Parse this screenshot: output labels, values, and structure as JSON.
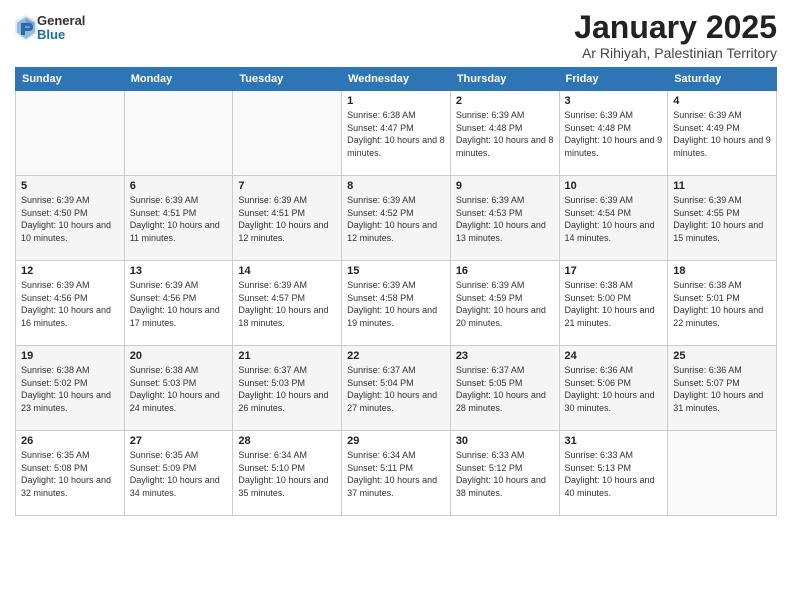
{
  "header": {
    "logo": {
      "general": "General",
      "blue": "Blue"
    },
    "title": "January 2025",
    "subtitle": "Ar Rihiyah, Palestinian Territory"
  },
  "calendar": {
    "weekdays": [
      "Sunday",
      "Monday",
      "Tuesday",
      "Wednesday",
      "Thursday",
      "Friday",
      "Saturday"
    ],
    "weeks": [
      [
        {
          "day": "",
          "sunrise": "",
          "sunset": "",
          "daylight": ""
        },
        {
          "day": "",
          "sunrise": "",
          "sunset": "",
          "daylight": ""
        },
        {
          "day": "",
          "sunrise": "",
          "sunset": "",
          "daylight": ""
        },
        {
          "day": "1",
          "sunrise": "Sunrise: 6:38 AM",
          "sunset": "Sunset: 4:47 PM",
          "daylight": "Daylight: 10 hours and 8 minutes."
        },
        {
          "day": "2",
          "sunrise": "Sunrise: 6:39 AM",
          "sunset": "Sunset: 4:48 PM",
          "daylight": "Daylight: 10 hours and 8 minutes."
        },
        {
          "day": "3",
          "sunrise": "Sunrise: 6:39 AM",
          "sunset": "Sunset: 4:48 PM",
          "daylight": "Daylight: 10 hours and 9 minutes."
        },
        {
          "day": "4",
          "sunrise": "Sunrise: 6:39 AM",
          "sunset": "Sunset: 4:49 PM",
          "daylight": "Daylight: 10 hours and 9 minutes."
        }
      ],
      [
        {
          "day": "5",
          "sunrise": "Sunrise: 6:39 AM",
          "sunset": "Sunset: 4:50 PM",
          "daylight": "Daylight: 10 hours and 10 minutes."
        },
        {
          "day": "6",
          "sunrise": "Sunrise: 6:39 AM",
          "sunset": "Sunset: 4:51 PM",
          "daylight": "Daylight: 10 hours and 11 minutes."
        },
        {
          "day": "7",
          "sunrise": "Sunrise: 6:39 AM",
          "sunset": "Sunset: 4:51 PM",
          "daylight": "Daylight: 10 hours and 12 minutes."
        },
        {
          "day": "8",
          "sunrise": "Sunrise: 6:39 AM",
          "sunset": "Sunset: 4:52 PM",
          "daylight": "Daylight: 10 hours and 12 minutes."
        },
        {
          "day": "9",
          "sunrise": "Sunrise: 6:39 AM",
          "sunset": "Sunset: 4:53 PM",
          "daylight": "Daylight: 10 hours and 13 minutes."
        },
        {
          "day": "10",
          "sunrise": "Sunrise: 6:39 AM",
          "sunset": "Sunset: 4:54 PM",
          "daylight": "Daylight: 10 hours and 14 minutes."
        },
        {
          "day": "11",
          "sunrise": "Sunrise: 6:39 AM",
          "sunset": "Sunset: 4:55 PM",
          "daylight": "Daylight: 10 hours and 15 minutes."
        }
      ],
      [
        {
          "day": "12",
          "sunrise": "Sunrise: 6:39 AM",
          "sunset": "Sunset: 4:56 PM",
          "daylight": "Daylight: 10 hours and 16 minutes."
        },
        {
          "day": "13",
          "sunrise": "Sunrise: 6:39 AM",
          "sunset": "Sunset: 4:56 PM",
          "daylight": "Daylight: 10 hours and 17 minutes."
        },
        {
          "day": "14",
          "sunrise": "Sunrise: 6:39 AM",
          "sunset": "Sunset: 4:57 PM",
          "daylight": "Daylight: 10 hours and 18 minutes."
        },
        {
          "day": "15",
          "sunrise": "Sunrise: 6:39 AM",
          "sunset": "Sunset: 4:58 PM",
          "daylight": "Daylight: 10 hours and 19 minutes."
        },
        {
          "day": "16",
          "sunrise": "Sunrise: 6:39 AM",
          "sunset": "Sunset: 4:59 PM",
          "daylight": "Daylight: 10 hours and 20 minutes."
        },
        {
          "day": "17",
          "sunrise": "Sunrise: 6:38 AM",
          "sunset": "Sunset: 5:00 PM",
          "daylight": "Daylight: 10 hours and 21 minutes."
        },
        {
          "day": "18",
          "sunrise": "Sunrise: 6:38 AM",
          "sunset": "Sunset: 5:01 PM",
          "daylight": "Daylight: 10 hours and 22 minutes."
        }
      ],
      [
        {
          "day": "19",
          "sunrise": "Sunrise: 6:38 AM",
          "sunset": "Sunset: 5:02 PM",
          "daylight": "Daylight: 10 hours and 23 minutes."
        },
        {
          "day": "20",
          "sunrise": "Sunrise: 6:38 AM",
          "sunset": "Sunset: 5:03 PM",
          "daylight": "Daylight: 10 hours and 24 minutes."
        },
        {
          "day": "21",
          "sunrise": "Sunrise: 6:37 AM",
          "sunset": "Sunset: 5:03 PM",
          "daylight": "Daylight: 10 hours and 26 minutes."
        },
        {
          "day": "22",
          "sunrise": "Sunrise: 6:37 AM",
          "sunset": "Sunset: 5:04 PM",
          "daylight": "Daylight: 10 hours and 27 minutes."
        },
        {
          "day": "23",
          "sunrise": "Sunrise: 6:37 AM",
          "sunset": "Sunset: 5:05 PM",
          "daylight": "Daylight: 10 hours and 28 minutes."
        },
        {
          "day": "24",
          "sunrise": "Sunrise: 6:36 AM",
          "sunset": "Sunset: 5:06 PM",
          "daylight": "Daylight: 10 hours and 30 minutes."
        },
        {
          "day": "25",
          "sunrise": "Sunrise: 6:36 AM",
          "sunset": "Sunset: 5:07 PM",
          "daylight": "Daylight: 10 hours and 31 minutes."
        }
      ],
      [
        {
          "day": "26",
          "sunrise": "Sunrise: 6:35 AM",
          "sunset": "Sunset: 5:08 PM",
          "daylight": "Daylight: 10 hours and 32 minutes."
        },
        {
          "day": "27",
          "sunrise": "Sunrise: 6:35 AM",
          "sunset": "Sunset: 5:09 PM",
          "daylight": "Daylight: 10 hours and 34 minutes."
        },
        {
          "day": "28",
          "sunrise": "Sunrise: 6:34 AM",
          "sunset": "Sunset: 5:10 PM",
          "daylight": "Daylight: 10 hours and 35 minutes."
        },
        {
          "day": "29",
          "sunrise": "Sunrise: 6:34 AM",
          "sunset": "Sunset: 5:11 PM",
          "daylight": "Daylight: 10 hours and 37 minutes."
        },
        {
          "day": "30",
          "sunrise": "Sunrise: 6:33 AM",
          "sunset": "Sunset: 5:12 PM",
          "daylight": "Daylight: 10 hours and 38 minutes."
        },
        {
          "day": "31",
          "sunrise": "Sunrise: 6:33 AM",
          "sunset": "Sunset: 5:13 PM",
          "daylight": "Daylight: 10 hours and 40 minutes."
        },
        {
          "day": "",
          "sunrise": "",
          "sunset": "",
          "daylight": ""
        }
      ]
    ]
  }
}
